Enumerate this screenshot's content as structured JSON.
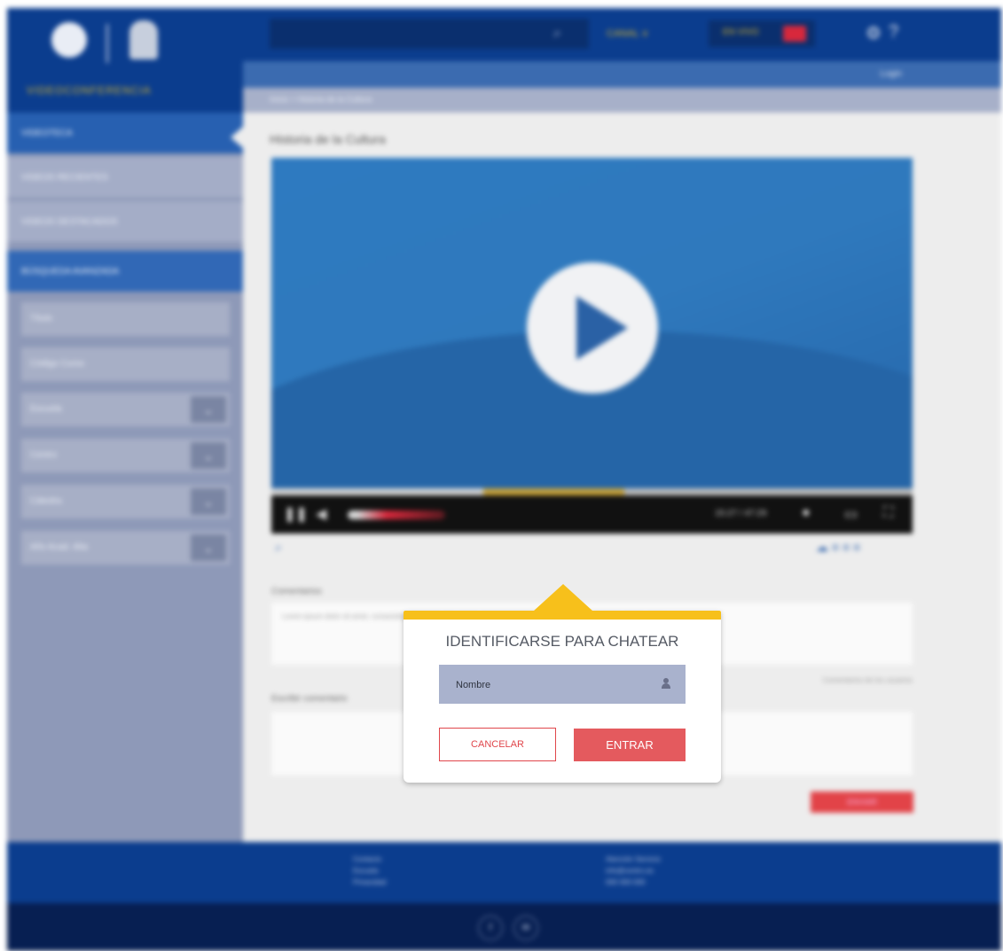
{
  "sidebar": {
    "brand": "VIDEOCONFERENCIA",
    "items": [
      {
        "label": "VIDEOTECA"
      },
      {
        "label": "VIDEOS RECIENTES"
      },
      {
        "label": "VIDEOS DESTACADOS"
      },
      {
        "label": "BÚSQUEDA AVANZADA"
      }
    ],
    "filters": [
      {
        "label": "Título"
      },
      {
        "label": "Código Curso"
      },
      {
        "label": "Escuela"
      },
      {
        "label": "Centro"
      },
      {
        "label": "Cátedra"
      },
      {
        "label": "Año Acad. Alta"
      }
    ]
  },
  "topbar": {
    "search_icon": "search-icon",
    "canal_label": "CANAL ∨",
    "envivo_label": "EN VIVO",
    "icons": [
      "settings-icon",
      "help-icon"
    ],
    "link": "Login"
  },
  "breadcrumb": "Inicio > Historia de la Cultura",
  "video": {
    "title": "Historia de la Cultura",
    "time": "15:27 / 47:29",
    "played_fraction": 0.33,
    "buffered_fraction": 0.55
  },
  "comments": {
    "label": "Comentarios",
    "text": "Lorem ipsum dolor sit amet, consectetur adipiscing elit, sed do eiusmod tempor incididunt ut labore et dolore magna aliqua.",
    "note": "Comentarios de los usuarios",
    "write_label": "Escribir comentario",
    "send_label": "ENVIAR"
  },
  "footer": {
    "col1": [
      "Contacto",
      "Escuela",
      "Privacidad"
    ],
    "col2": [
      "Atención Servicio",
      "info@centro.es",
      "000 000 000"
    ],
    "social": [
      "f",
      "✉"
    ]
  },
  "modal": {
    "title": "IDENTIFICARSE PARA CHATEAR",
    "name_placeholder": "Nombre",
    "cancel_label": "CANCELAR",
    "enter_label": "ENTRAR",
    "accent_color": "#f7c01b",
    "button_color": "#e45a5e"
  }
}
